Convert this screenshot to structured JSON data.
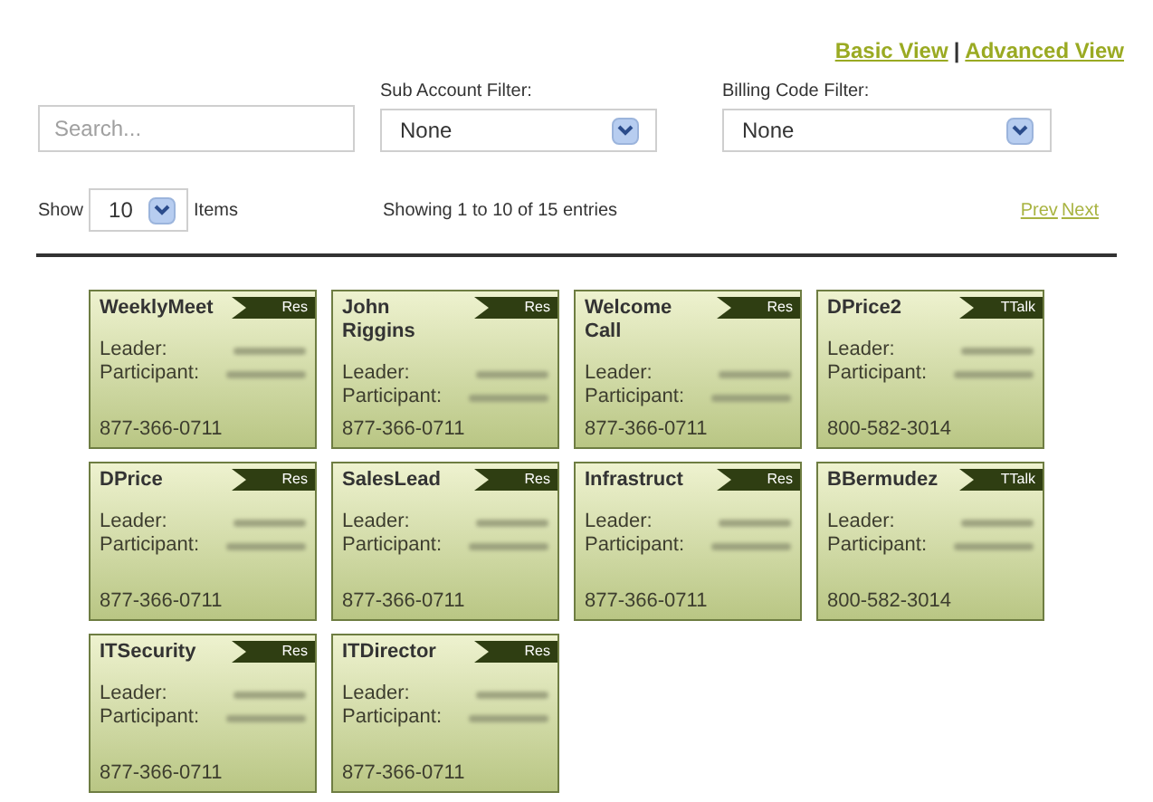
{
  "view_links": [
    {
      "label": "Basic View"
    },
    {
      "label": "Advanced View"
    }
  ],
  "separator": "|",
  "search": {
    "placeholder": "Search..."
  },
  "filters": [
    {
      "label": "Sub Account Filter:",
      "value": "None"
    },
    {
      "label": "Billing Code Filter:",
      "value": "None"
    }
  ],
  "page_size": {
    "prefix": "Show",
    "value": "10",
    "suffix": "Items"
  },
  "summary": "Showing 1 to 10 of 15 entries",
  "pager": [
    {
      "label": "Prev"
    },
    {
      "label": "Next"
    }
  ],
  "cards": [
    {
      "title": "WeeklyMeet",
      "tag": "Res",
      "leader_label": "Leader:",
      "participant_label": "Participant:",
      "phone": "877-366-0711"
    },
    {
      "title": "John Riggins",
      "tag": "Res",
      "leader_label": "Leader:",
      "participant_label": "Participant:",
      "phone": "877-366-0711"
    },
    {
      "title": "Welcome Call",
      "tag": "Res",
      "leader_label": "Leader:",
      "participant_label": "Participant:",
      "phone": "877-366-0711"
    },
    {
      "title": "DPrice2",
      "tag": "TTalk",
      "leader_label": "Leader:",
      "participant_label": "Participant:",
      "phone": "800-582-3014"
    },
    {
      "title": "DPrice",
      "tag": "Res",
      "leader_label": "Leader:",
      "participant_label": "Participant:",
      "phone": "877-366-0711"
    },
    {
      "title": "SalesLead",
      "tag": "Res",
      "leader_label": "Leader:",
      "participant_label": "Participant:",
      "phone": "877-366-0711"
    },
    {
      "title": "Infrastruct",
      "tag": "Res",
      "leader_label": "Leader:",
      "participant_label": "Participant:",
      "phone": "877-366-0711"
    },
    {
      "title": "BBermudez",
      "tag": "TTalk",
      "leader_label": "Leader:",
      "participant_label": "Participant:",
      "phone": "800-582-3014"
    },
    {
      "title": "ITSecurity",
      "tag": "Res",
      "leader_label": "Leader:",
      "participant_label": "Participant:",
      "phone": "877-366-0711"
    },
    {
      "title": "ITDirector",
      "tag": "Res",
      "leader_label": "Leader:",
      "participant_label": "Participant:",
      "phone": "877-366-0711"
    }
  ]
}
